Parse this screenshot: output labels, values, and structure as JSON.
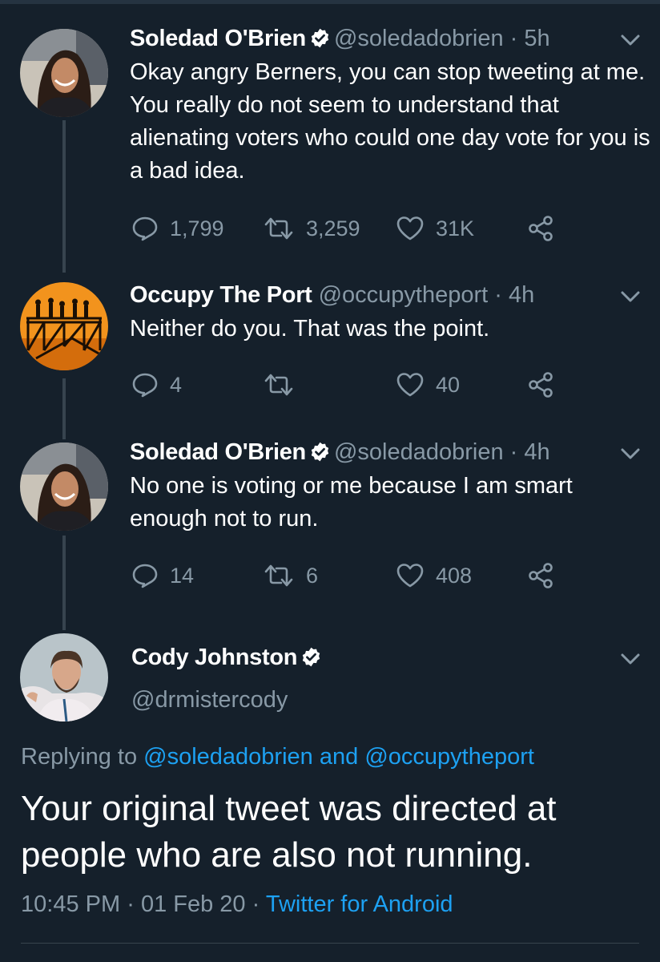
{
  "thread": [
    {
      "name": "Soledad O'Brien",
      "verified": true,
      "handle": "@soledadobrien",
      "separator": "·",
      "time": "5h",
      "text": "Okay angry Berners, you can stop tweeting at me. You really do not seem to understand that alienating voters who could one day vote for you is a bad idea.",
      "replies": "1,799",
      "retweets": "3,259",
      "likes": "31K"
    },
    {
      "name": "Occupy The Port",
      "verified": false,
      "handle": "@occupytheport",
      "separator": "·",
      "time": "4h",
      "text": "Neither do you. That was the point.",
      "replies": "4",
      "retweets": "",
      "likes": "40"
    },
    {
      "name": "Soledad O'Brien",
      "verified": true,
      "handle": "@soledadobrien",
      "separator": "·",
      "time": "4h",
      "text": "No one is voting or me because I am smart enough not to run.",
      "replies": "14",
      "retweets": "6",
      "likes": "408"
    }
  ],
  "main": {
    "name": "Cody Johnston",
    "verified": true,
    "handle": "@drmistercody",
    "replying_prefix": "Replying to",
    "mention_1": "@soledadobrien",
    "and_word": "and",
    "mention_2": "@occupytheport",
    "text": "Your original tweet was directed at people who are also not running.",
    "time": "10:45 PM",
    "separator": "·",
    "date": "01 Feb 20",
    "source": "Twitter for Android"
  },
  "icons": {
    "reply": "reply-icon",
    "retweet": "retweet-icon",
    "like": "heart-icon",
    "share": "share-icon",
    "verified": "verified-badge-icon",
    "more": "chevron-down-icon"
  },
  "colors": {
    "background": "#15202b",
    "accent": "#1da1f2",
    "muted": "#8899a6",
    "text": "#ffffff"
  }
}
